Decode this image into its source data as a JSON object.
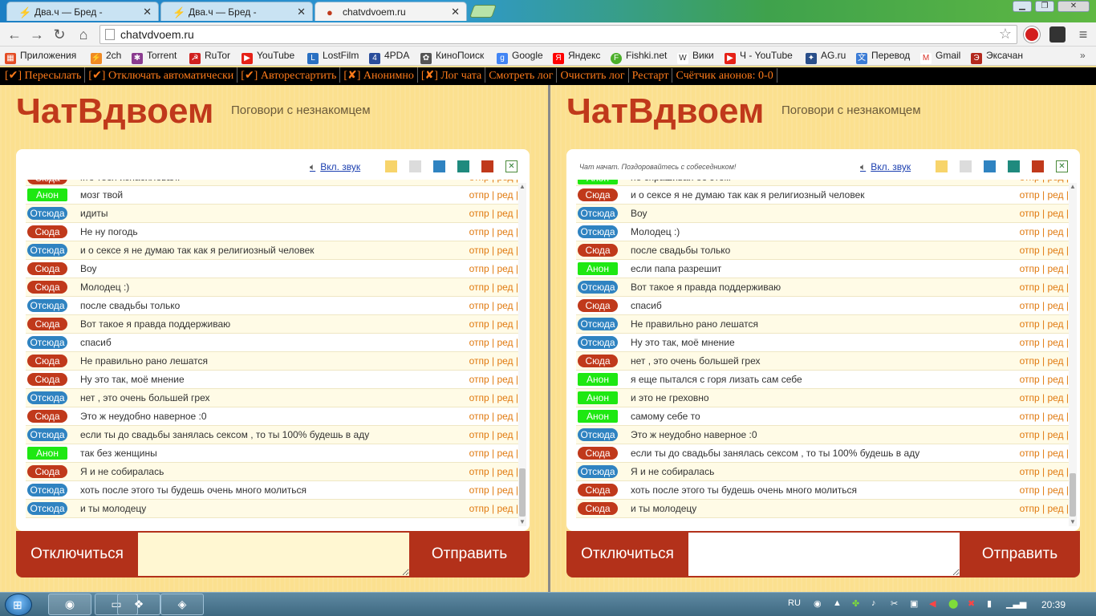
{
  "browser": {
    "tabs": [
      {
        "title": "Два.ч — Бред -",
        "icon": "lightning-icon"
      },
      {
        "title": "Два.ч — Бред -",
        "icon": "lightning-icon"
      },
      {
        "title": "chatvdvoem.ru",
        "icon": "speech-bubble-icon"
      }
    ],
    "url": "chatvdvoem.ru",
    "bookmarks": [
      {
        "label": "Приложения",
        "icon": "apps-grid-icon",
        "color": "#e44d26"
      },
      {
        "label": "2ch",
        "icon": "lightning-icon",
        "color": "#f08a24"
      },
      {
        "label": "Torrent",
        "icon": "torrent-icon",
        "color": "#8a3b8f"
      },
      {
        "label": "RuTor",
        "icon": "rutor-icon",
        "color": "#d0201f"
      },
      {
        "label": "YouTube",
        "icon": "youtube-icon",
        "color": "#e62117"
      },
      {
        "label": "LostFilm",
        "icon": "lostfilm-icon",
        "color": "#2a70c2"
      },
      {
        "label": "4PDA",
        "icon": "4pda-icon",
        "color": "#2a4d9b"
      },
      {
        "label": "КиноПоиск",
        "icon": "kinopoisk-icon",
        "color": "#555555"
      },
      {
        "label": "Google",
        "icon": "google-icon",
        "color": "#4285f4"
      },
      {
        "label": "Яндекс",
        "icon": "yandex-icon",
        "color": "#ff0000"
      },
      {
        "label": "Fishki.net",
        "icon": "fishki-icon",
        "color": "#4caf2a"
      },
      {
        "label": "Вики",
        "icon": "wiki-icon",
        "color": "#333333"
      },
      {
        "label": "Ч - YouTube",
        "icon": "youtube-icon",
        "color": "#e62117"
      },
      {
        "label": "AG.ru",
        "icon": "ag-icon",
        "color": "#2a4f8a"
      },
      {
        "label": "Перевод",
        "icon": "translate-icon",
        "color": "#3a7bd5"
      },
      {
        "label": "Gmail",
        "icon": "gmail-icon",
        "color": "#d93025"
      },
      {
        "label": "Эксачан",
        "icon": "exachan-icon",
        "color": "#b3281d"
      }
    ]
  },
  "userbar": {
    "items": [
      "[✔] Пересылать",
      "[✔] Отключать автоматически",
      "[✔] Авторестартить",
      "[✘] Анонимно",
      "[✘] Лог чата",
      "Смотреть лог",
      "Очистить лог",
      "Рестарт",
      "Счётчик анонов: 0-0"
    ]
  },
  "site": {
    "logo": "ЧатВдвоем",
    "tagline": "Поговори с незнакомцем",
    "sound_label": "Вкл. звук",
    "swatch_colors": [
      "#f7d46b",
      "#dcdcdc",
      "#2f83c1",
      "#1f8a7e",
      "#c0391b"
    ],
    "action_label": "отпр | ред |",
    "disconnect_label": "Отключиться",
    "send_label": "Отправить"
  },
  "badges": {
    "sy": {
      "label": "Сюда",
      "color": "#c0391b"
    },
    "ot": {
      "label": "Отсюда",
      "color": "#2f83c1"
    },
    "an": {
      "label": "Анон",
      "color": "#1ee812"
    }
  },
  "left_chat": {
    "status": "",
    "messages": [
      {
        "who": "sy",
        "text": "кто тебя изнасиловал:"
      },
      {
        "who": "an",
        "text": "мозг твой"
      },
      {
        "who": "ot",
        "text": "идиты"
      },
      {
        "who": "sy",
        "text": "Не ну погодь"
      },
      {
        "who": "ot",
        "text": "и о сексе я не думаю так как я религиозный человек"
      },
      {
        "who": "sy",
        "text": "Воу"
      },
      {
        "who": "sy",
        "text": "Молодец :)"
      },
      {
        "who": "ot",
        "text": "после свадьбы только"
      },
      {
        "who": "sy",
        "text": "Вот такое я правда поддерживаю"
      },
      {
        "who": "ot",
        "text": "спасиб"
      },
      {
        "who": "sy",
        "text": "Не правильно рано лешатся"
      },
      {
        "who": "sy",
        "text": "Ну это так, моё мнение"
      },
      {
        "who": "ot",
        "text": "нет , это очень большей грех"
      },
      {
        "who": "sy",
        "text": "Это ж неудобно наверное :0"
      },
      {
        "who": "ot",
        "text": "если ты до свадьбы занялась сексом , то ты 100% будешь в аду"
      },
      {
        "who": "an",
        "text": "так без женщины"
      },
      {
        "who": "sy",
        "text": "Я и не собиралась"
      },
      {
        "who": "ot",
        "text": "хоть после этого ты будешь очень много молиться"
      },
      {
        "who": "ot",
        "text": "и ты молодецу"
      }
    ]
  },
  "right_chat": {
    "status": "Чат начат. Поздоровайтесь с собеседником!",
    "messages": [
      {
        "who": "an",
        "text": "не спрашивай об этом"
      },
      {
        "who": "sy",
        "text": "и о сексе я не думаю так как я религиозный человек"
      },
      {
        "who": "ot",
        "text": "Воу"
      },
      {
        "who": "ot",
        "text": "Молодец :)"
      },
      {
        "who": "sy",
        "text": "после свадьбы только"
      },
      {
        "who": "an",
        "text": "если папа разрешит"
      },
      {
        "who": "ot",
        "text": "Вот такое я правда поддерживаю"
      },
      {
        "who": "sy",
        "text": "спасиб"
      },
      {
        "who": "ot",
        "text": "Не правильно рано лешатся"
      },
      {
        "who": "ot",
        "text": "Ну это так, моё мнение"
      },
      {
        "who": "sy",
        "text": "нет , это очень большей грех"
      },
      {
        "who": "an",
        "text": "я еще пытался с горя лизать сам себе"
      },
      {
        "who": "an",
        "text": "и это не греховно"
      },
      {
        "who": "an",
        "text": "самому себе то"
      },
      {
        "who": "ot",
        "text": "Это ж неудобно наверное :0"
      },
      {
        "who": "sy",
        "text": "если ты до свадьбы занялась сексом , то ты 100% будешь в аду"
      },
      {
        "who": "ot",
        "text": "Я и не собиралась"
      },
      {
        "who": "sy",
        "text": "хоть после этого ты будешь очень много молиться"
      },
      {
        "who": "sy",
        "text": "и ты молодецу"
      }
    ]
  },
  "taskbar": {
    "lang": "RU",
    "time": "20:39"
  }
}
